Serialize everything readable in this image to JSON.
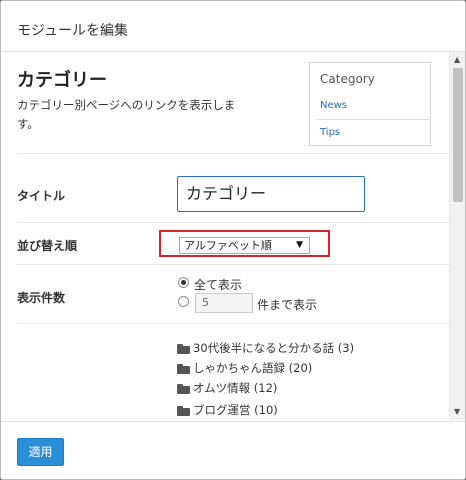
{
  "header": {
    "title": "モジュールを編集"
  },
  "module": {
    "title": "カテゴリー",
    "description": "カテゴリー別ページへのリンクを表示します。"
  },
  "preview": {
    "title": "Category",
    "items": [
      {
        "label": "News"
      },
      {
        "label": "Tips"
      }
    ]
  },
  "form": {
    "title_field": {
      "label": "タイトル",
      "value": "カテゴリー"
    },
    "sort_field": {
      "label": "並び替え順",
      "selected": "アルファベット順"
    },
    "count_field": {
      "label": "表示件数",
      "option_all": "全て表示",
      "option_limit_value": "5",
      "option_limit_suffix": "件まで表示",
      "selected": "全て表示"
    }
  },
  "categories": [
    {
      "label": "30代後半になると分かる話 (3)"
    },
    {
      "label": "しゃかちゃん語録 (20)"
    },
    {
      "label": "オムツ情報 (12)"
    },
    {
      "label": "ブログ運営 (10)"
    }
  ],
  "footer": {
    "apply_label": "適用"
  },
  "colors": {
    "accent": "#2b8ed9",
    "highlight": "#d9242b",
    "link": "#2a6db5"
  }
}
